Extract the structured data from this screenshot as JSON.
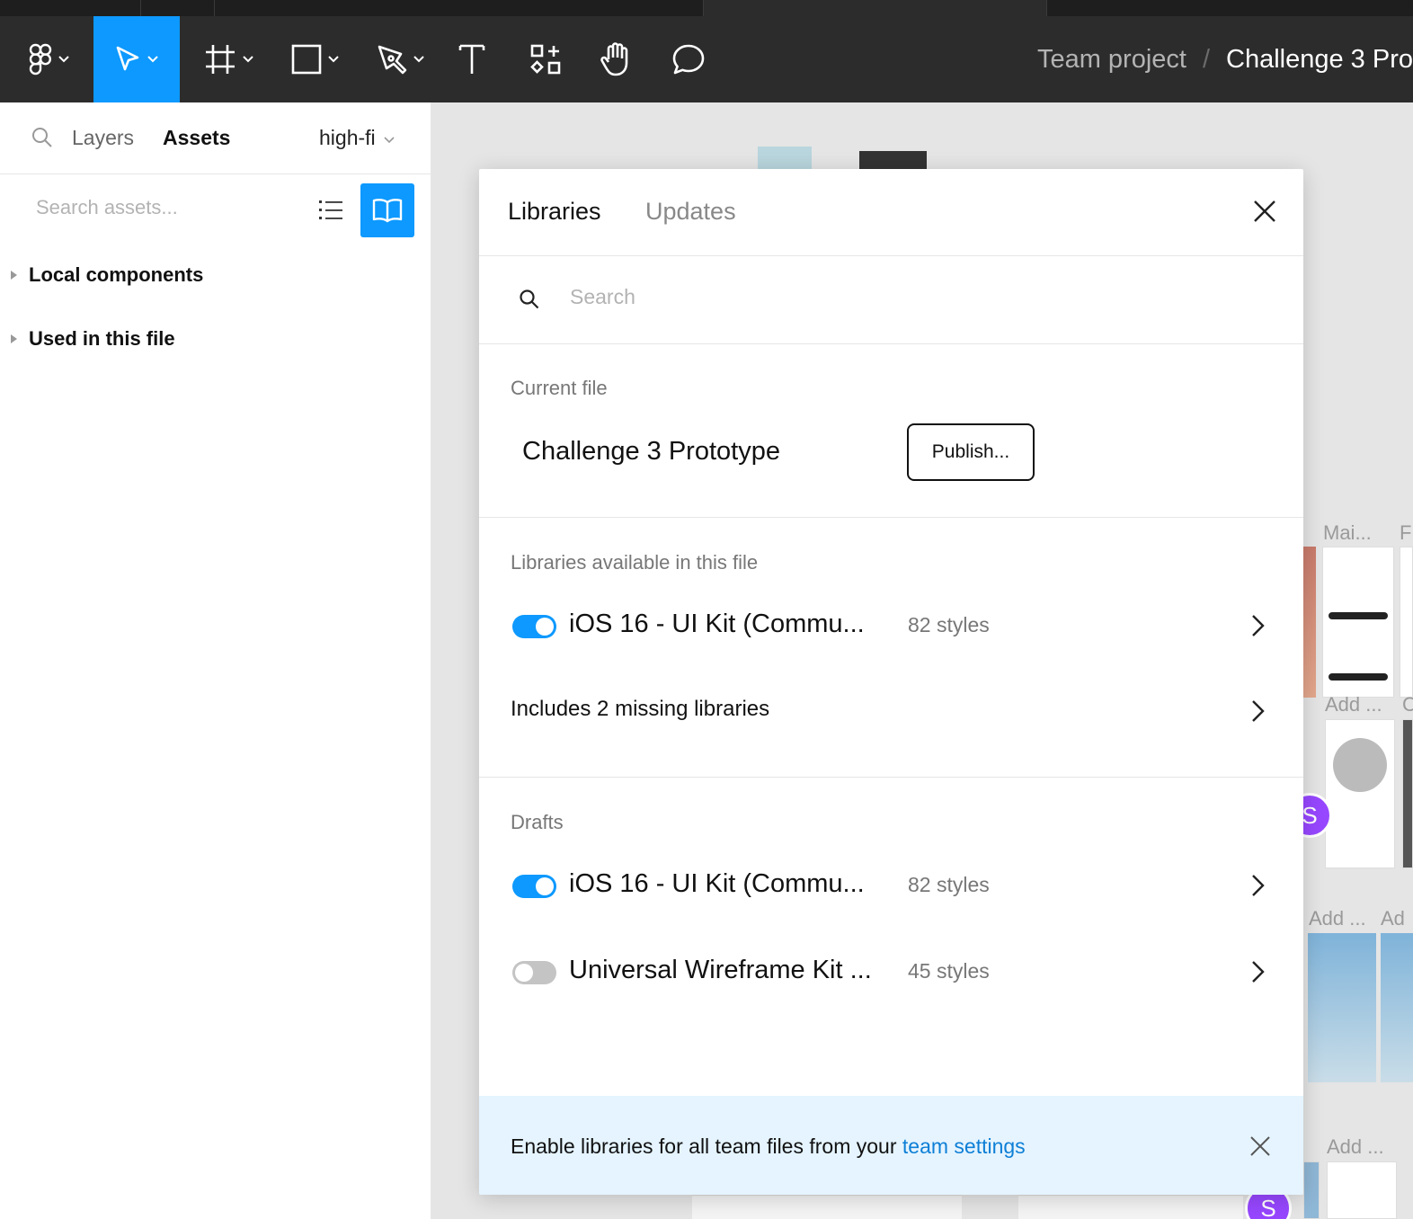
{
  "toolbar": {
    "breadcrumb_team": "Team project",
    "breadcrumb_separator": "/",
    "breadcrumb_file": "Challenge 3 Pro",
    "accent_color": "#0d99ff"
  },
  "left_panel": {
    "tab_layers": "Layers",
    "tab_assets": "Assets",
    "page_name": "high-fi",
    "search_placeholder": "Search assets...",
    "sections": [
      "Local components",
      "Used in this file"
    ]
  },
  "canvas": {
    "thumb_labels": [
      "Mai...",
      "F",
      "Add ...",
      "C",
      "Add ...",
      "Ad",
      "Add ..."
    ],
    "avatar_initial": "S"
  },
  "modal": {
    "tab_libraries": "Libraries",
    "tab_updates": "Updates",
    "search_placeholder": "Search",
    "current_file_label": "Current file",
    "current_file_name": "Challenge 3 Prototype",
    "publish_label": "Publish...",
    "available_label": "Libraries available in this file",
    "available_libs": [
      {
        "name": "iOS 16 - UI Kit (Commu...",
        "styles": "82 styles",
        "enabled": true
      }
    ],
    "missing_label": "Includes 2 missing libraries",
    "drafts_label": "Drafts",
    "drafts": [
      {
        "name": "iOS 16 - UI Kit (Commu...",
        "styles": "82 styles",
        "enabled": true
      },
      {
        "name": "Universal Wireframe Kit ...",
        "styles": "45 styles",
        "enabled": false
      }
    ],
    "footer_text": "Enable libraries for all team files from your ",
    "footer_link": "team settings",
    "footer_bg": "#e5f4ff"
  }
}
